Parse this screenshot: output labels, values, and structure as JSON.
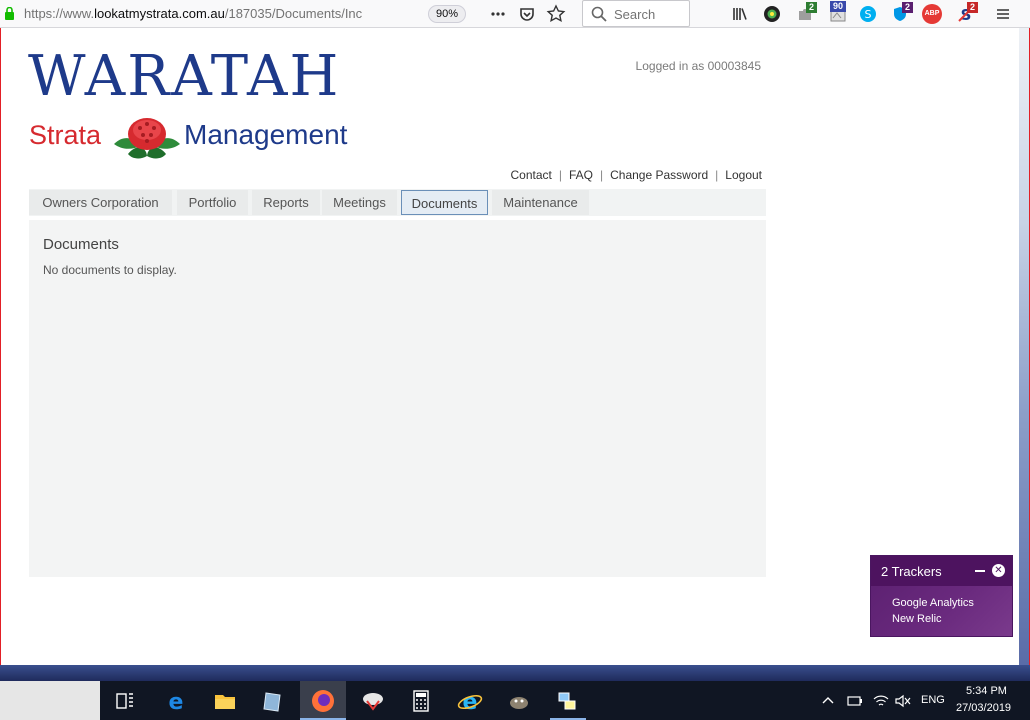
{
  "browser": {
    "url_prefix": "https://www.",
    "url_host": "lookatmystrata.com.au",
    "url_path": "/187035/Documents/Inc",
    "zoom": "90%",
    "search_placeholder": "Search",
    "ext_badges": [
      "2",
      "90",
      "2",
      "ABP",
      "2"
    ]
  },
  "site": {
    "logo_main": "WARATAH",
    "logo_strata": "Strata",
    "logo_management": "Management",
    "logged_in": "Logged in as 00003845",
    "util_links": [
      "Contact",
      "FAQ",
      "Change Password",
      "Logout"
    ],
    "tabs": [
      "Owners Corporation",
      "Portfolio",
      "Reports",
      "Meetings",
      "Documents",
      "Maintenance"
    ],
    "active_tab": "Documents",
    "content_title": "Documents",
    "content_empty": "No documents to display."
  },
  "trackers": {
    "title": "2 Trackers",
    "items": [
      "Google Analytics",
      "New Relic"
    ]
  },
  "taskbar": {
    "lang": "ENG",
    "time": "5:34 PM",
    "date": "27/03/2019"
  },
  "colors": {
    "logo_blue": "#1e3a8a",
    "logo_red": "#d62a2f",
    "tracker_purple": "#5a1f6f"
  }
}
